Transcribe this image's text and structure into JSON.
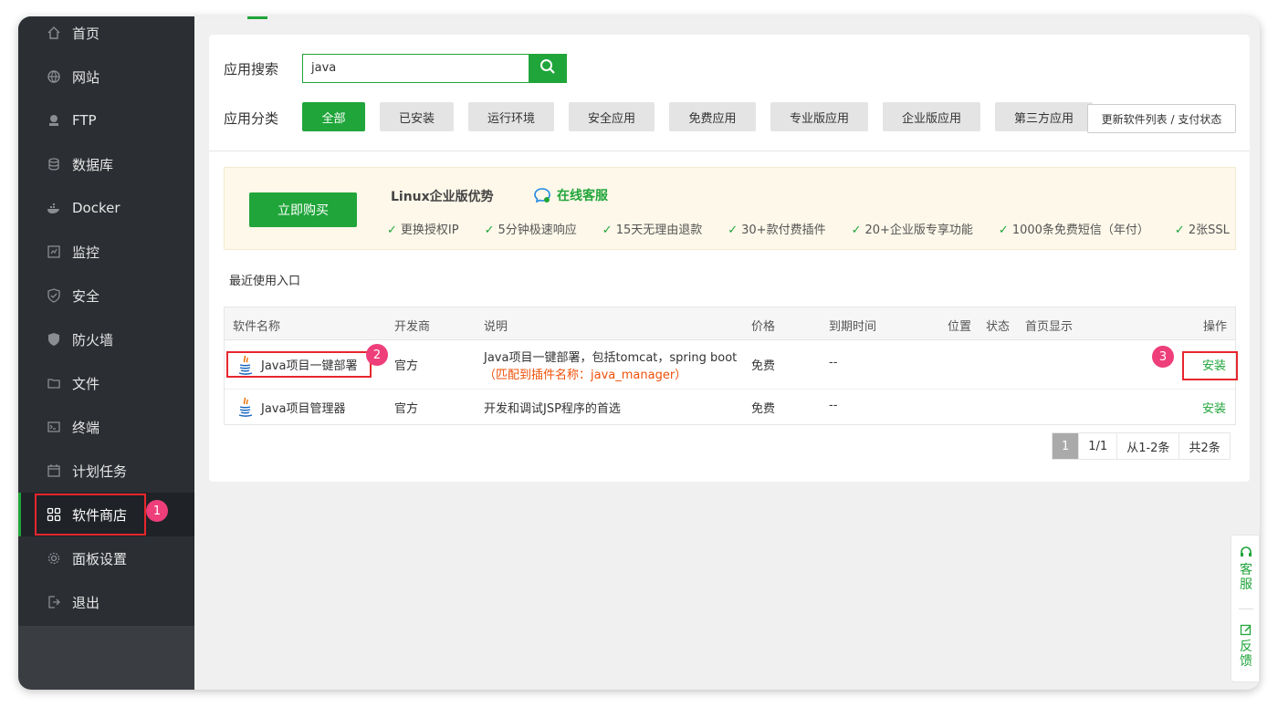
{
  "sidebar": {
    "items": [
      {
        "label": "首页",
        "icon": "home-icon"
      },
      {
        "label": "网站",
        "icon": "globe-icon"
      },
      {
        "label": "FTP",
        "icon": "ftp-icon"
      },
      {
        "label": "数据库",
        "icon": "database-icon"
      },
      {
        "label": "Docker",
        "icon": "docker-icon"
      },
      {
        "label": "监控",
        "icon": "monitor-icon"
      },
      {
        "label": "安全",
        "icon": "shield-icon"
      },
      {
        "label": "防火墙",
        "icon": "firewall-icon"
      },
      {
        "label": "文件",
        "icon": "folder-icon"
      },
      {
        "label": "终端",
        "icon": "terminal-icon"
      },
      {
        "label": "计划任务",
        "icon": "calendar-icon"
      },
      {
        "label": "软件商店",
        "icon": "grid-icon",
        "active": true
      },
      {
        "label": "面板设置",
        "icon": "gear-icon"
      },
      {
        "label": "退出",
        "icon": "logout-icon"
      }
    ]
  },
  "search": {
    "label": "应用搜索",
    "value": "java"
  },
  "categories": {
    "label": "应用分类",
    "items": [
      "全部",
      "已安装",
      "运行环境",
      "安全应用",
      "免费应用",
      "专业版应用",
      "企业版应用",
      "第三方应用"
    ],
    "active": "全部"
  },
  "update_button": "更新软件列表 / 支付状态",
  "promo": {
    "buy_button": "立即购买",
    "title": "Linux企业版优势",
    "service": "在线客服",
    "features": [
      "更换授权IP",
      "5分钟极速响应",
      "15天无理由退款",
      "30+款付费插件",
      "20+企业版专享功能",
      "1000条免费短信（年付）",
      "2张SSL"
    ]
  },
  "recent_label": "最近使用入口",
  "table": {
    "headers": {
      "name": "软件名称",
      "developer": "开发商",
      "description": "说明",
      "price": "价格",
      "expiry": "到期时间",
      "location": "位置",
      "status": "状态",
      "homepage": "首页显示",
      "action": "操作"
    },
    "rows": [
      {
        "name": "Java项目一键部署",
        "developer": "官方",
        "description": "Java项目一键部署，包括tomcat，spring boot",
        "note": "（匹配到插件名称：java_manager）",
        "price": "免费",
        "expiry": "--",
        "action": "安装"
      },
      {
        "name": "Java项目管理器",
        "developer": "官方",
        "description": "开发和调试JSP程序的首选",
        "price": "免费",
        "expiry": "--",
        "action": "安装"
      }
    ]
  },
  "pager": {
    "current": "1",
    "pages": "1/1",
    "range": "从1-2条",
    "total": "共2条"
  },
  "annotations": {
    "badge1": "1",
    "badge2": "2",
    "badge3": "3"
  },
  "float_panel": {
    "service": "客服",
    "feedback": "反馈"
  },
  "colors": {
    "accent": "#20a53a",
    "sidebar_bg": "#2b2e33",
    "highlight": "#e8262d",
    "badge": "#ee3f7a",
    "note": "#f0500a"
  }
}
